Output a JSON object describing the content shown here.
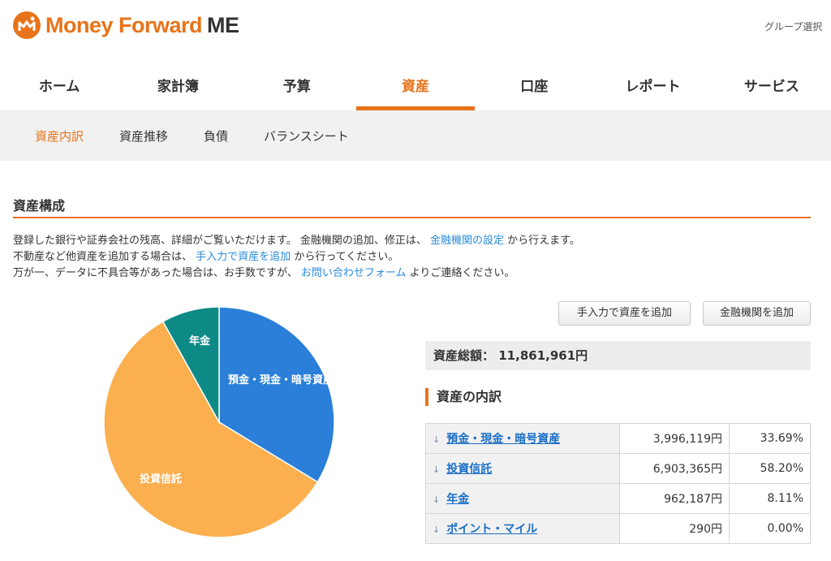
{
  "brand": {
    "name": "Money Forward",
    "suffix": "ME",
    "logo_icon": "money-forward-logo-icon",
    "color": "#e8731a"
  },
  "header": {
    "group_select": "グループ選択"
  },
  "nav": {
    "items": [
      "ホーム",
      "家計簿",
      "予算",
      "資産",
      "口座",
      "レポート",
      "サービス"
    ],
    "active": "資産"
  },
  "subnav": {
    "items": [
      "資産内訳",
      "資産推移",
      "負債",
      "バランスシート"
    ],
    "active": "資産内訳"
  },
  "section": {
    "title": "資産構成",
    "line1_pre": "登録した銀行や証券会社の残高、詳細がご覧いただけます。 金融機関の追加、修正は、",
    "line1_link": "金融機関の設定",
    "line1_post": "から行えます。",
    "line2_pre": "不動産など他資産を追加する場合は、",
    "line2_link": "手入力で資産を追加",
    "line2_post": "から行ってください。",
    "line3_pre": "万が一、データに不具合等があった場合は、お手数ですが、",
    "line3_link": "お問い合わせフォーム",
    "line3_post": "よりご連絡ください。"
  },
  "buttons": {
    "manual_add": "手入力で資産を追加",
    "institution_add": "金融機関を追加"
  },
  "total": {
    "label": "資産総額：",
    "value": "11,861,961円"
  },
  "breakdown": {
    "title": "資産の内訳",
    "rows": [
      {
        "name": "預金・現金・暗号資産",
        "amount": "3,996,119円",
        "percent": "33.69%"
      },
      {
        "name": "投資信託",
        "amount": "6,903,365円",
        "percent": "58.20%"
      },
      {
        "name": "年金",
        "amount": "962,187円",
        "percent": "8.11%"
      },
      {
        "name": "ポイント・マイル",
        "amount": "290円",
        "percent": "0.00%"
      }
    ]
  },
  "chart_data": {
    "type": "pie",
    "slices": [
      {
        "label": "預金・現金・暗号資産",
        "value": 33.69,
        "color": "#2b7fd8"
      },
      {
        "label": "投資信託",
        "value": 58.2,
        "color": "#fbaf4f"
      },
      {
        "label": "年金",
        "value": 8.11,
        "color": "#0e8a86"
      },
      {
        "label": "ポイント・マイル",
        "value": 0.0,
        "color": "#888888"
      }
    ]
  }
}
